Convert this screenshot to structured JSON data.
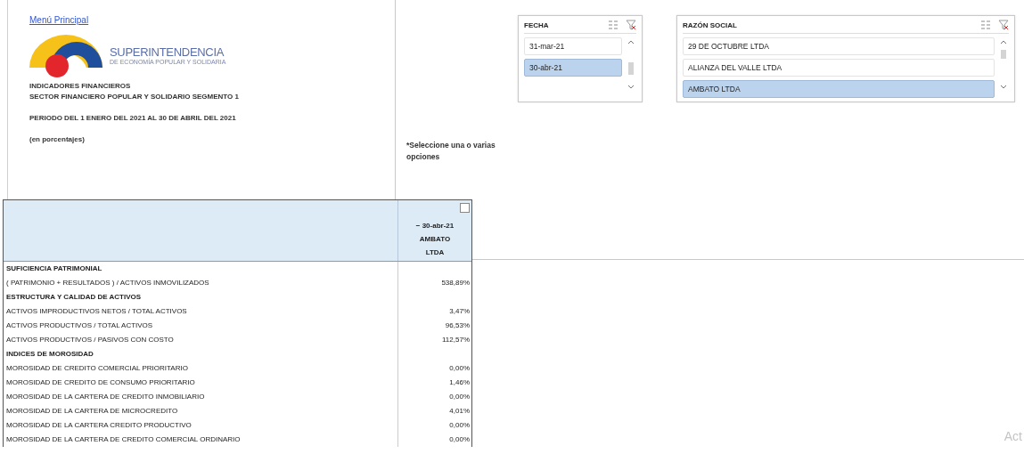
{
  "menu_link": "Menú Principal",
  "logo": {
    "name": "SUPERINTENDENCIA",
    "subtitle": "DE ECONOMÍA POPULAR Y SOLIDARIA"
  },
  "header_lines": [
    "INDICADORES FINANCIEROS",
    "SECTOR FINANCIERO POPULAR Y SOLIDARIO SEGMENTO 1",
    "PERIODO DEL 1 ENERO DEL 2021 AL 30 DE ABRIL DEL 2021",
    "(en porcentajes)"
  ],
  "hint": "*Seleccione una o varias opciones",
  "slicers": [
    {
      "title": "FECHA",
      "items": [
        {
          "label": "31-mar-21",
          "selected": false
        },
        {
          "label": "30-abr-21",
          "selected": true
        }
      ]
    },
    {
      "title": "RAZÓN SOCIAL",
      "items": [
        {
          "label": "29 DE OCTUBRE LTDA",
          "selected": false
        },
        {
          "label": "ALIANZA DEL VALLE LTDA",
          "selected": false
        },
        {
          "label": "AMBATO LTDA",
          "selected": true
        }
      ]
    }
  ],
  "table": {
    "column_header": {
      "collapse": "−",
      "date": "30-abr-21",
      "entity": "AMBATO LTDA"
    },
    "rows": [
      {
        "kind": "section",
        "label": "SUFICIENCIA PATRIMONIAL"
      },
      {
        "kind": "value",
        "label": "( PATRIMONIO + RESULTADOS ) / ACTIVOS INMOVILIZADOS",
        "value": "538,89%"
      },
      {
        "kind": "section",
        "label": "ESTRUCTURA Y CALIDAD DE ACTIVOS"
      },
      {
        "kind": "value",
        "label": "ACTIVOS IMPRODUCTIVOS NETOS / TOTAL ACTIVOS",
        "value": "3,47%"
      },
      {
        "kind": "value",
        "label": "ACTIVOS PRODUCTIVOS / TOTAL ACTIVOS",
        "value": "96,53%"
      },
      {
        "kind": "value",
        "label": "ACTIVOS PRODUCTIVOS / PASIVOS CON COSTO",
        "value": "112,57%"
      },
      {
        "kind": "section",
        "label": "INDICES DE MOROSIDAD"
      },
      {
        "kind": "value",
        "label": "MOROSIDAD DE CREDITO COMERCIAL PRIORITARIO",
        "value": "0,00%"
      },
      {
        "kind": "value",
        "label": "MOROSIDAD DE CREDITO DE CONSUMO PRIORITARIO",
        "value": "1,46%"
      },
      {
        "kind": "value",
        "label": "MOROSIDAD DE LA CARTERA DE CREDITO INMOBILIARIO",
        "value": "0,00%"
      },
      {
        "kind": "value",
        "label": "MOROSIDAD DE LA CARTERA DE MICROCREDITO",
        "value": "4,01%"
      },
      {
        "kind": "value",
        "label": "MOROSIDAD DE LA CARTERA CREDITO PRODUCTIVO",
        "value": "0,00%"
      },
      {
        "kind": "value",
        "label": "MOROSIDAD DE LA CARTERA DE CREDITO COMERCIAL ORDINARIO",
        "value": "0,00%"
      }
    ]
  },
  "watermark_text": "Act"
}
